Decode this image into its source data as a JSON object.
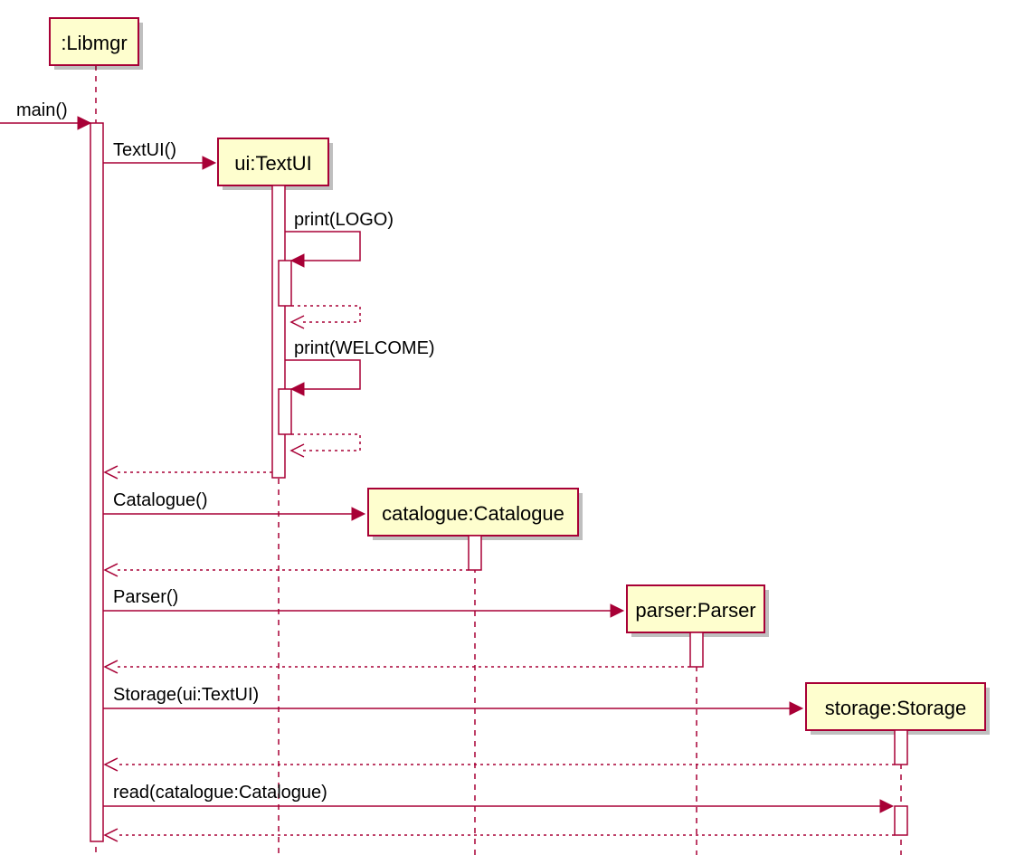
{
  "participants": {
    "libmgr": ":Libmgr",
    "textui": "ui:TextUI",
    "catalogue": "catalogue:Catalogue",
    "parser": "parser:Parser",
    "storage": "storage:Storage"
  },
  "messages": {
    "main": "main()",
    "textui_ctor": "TextUI()",
    "print_logo": "print(LOGO)",
    "print_welcome": "print(WELCOME)",
    "catalogue_ctor": "Catalogue()",
    "parser_ctor": "Parser()",
    "storage_ctor": "Storage(ui:TextUI)",
    "read_catalogue": "read(catalogue:Catalogue)"
  },
  "colors": {
    "accent": "#A80036",
    "fill": "#FEFECE"
  }
}
